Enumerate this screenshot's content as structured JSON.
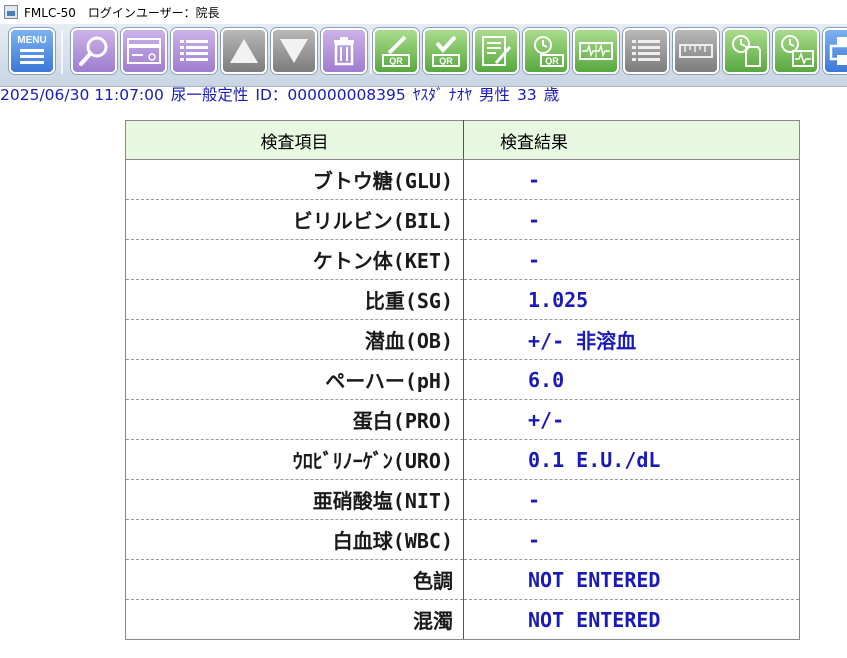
{
  "window": {
    "app_name": "FMLC-50",
    "login_user": "ログインユーザー：院長"
  },
  "toolbar": {
    "menu_label": "MENU",
    "buttons": [
      {
        "icon": "menu-icon",
        "color": "blue"
      },
      {
        "icon": "magnifier-icon",
        "color": "purple"
      },
      {
        "icon": "card-icon",
        "color": "purple"
      },
      {
        "icon": "list-icon",
        "color": "purple"
      },
      {
        "icon": "arrow-up-icon",
        "color": "gray"
      },
      {
        "icon": "arrow-down-icon",
        "color": "gray"
      },
      {
        "icon": "trash-icon",
        "color": "purple"
      },
      {
        "icon": "edit-qr-icon",
        "color": "green"
      },
      {
        "icon": "check-qr-icon",
        "color": "green"
      },
      {
        "icon": "report-edit-icon",
        "color": "green"
      },
      {
        "icon": "clock-qr-icon",
        "color": "green"
      },
      {
        "icon": "waveform-icon",
        "color": "green"
      },
      {
        "icon": "list-icon",
        "color": "gray"
      },
      {
        "icon": "ruler-icon",
        "color": "gray"
      },
      {
        "icon": "clock-doc-icon",
        "color": "green"
      },
      {
        "icon": "clock-wave-icon",
        "color": "green"
      },
      {
        "icon": "printer-icon",
        "color": "blue"
      }
    ],
    "qr_text": "QR"
  },
  "patient": {
    "datetime": "2025/06/30 11:07:00",
    "test_type": "尿一般定性",
    "id": "ID：000000008395",
    "name": "ﾔｽﾀﾞ ﾅｵﾔ",
    "sex": "男性",
    "age": "33",
    "age_unit": "歳"
  },
  "table": {
    "headers": [
      "検査項目",
      "検査結果"
    ],
    "rows": [
      {
        "item": "ブトウ糖(GLU)",
        "result": "-"
      },
      {
        "item": "ビリルビン(BIL)",
        "result": "-"
      },
      {
        "item": "ケトン体(KET)",
        "result": "-"
      },
      {
        "item": "比重(SG)",
        "result": "1.025"
      },
      {
        "item": "潜血(OB)",
        "result": "+/- 非溶血"
      },
      {
        "item": "ペーハー(pH)",
        "result": "6.0"
      },
      {
        "item": "蛋白(PRO)",
        "result": "+/-"
      },
      {
        "item": "ｳﾛﾋﾞﾘﾉｰｹﾞﾝ(URO)",
        "result": "0.1 E.U./dL"
      },
      {
        "item": "亜硝酸塩(NIT)",
        "result": "-"
      },
      {
        "item": "白血球(WBC)",
        "result": "-"
      },
      {
        "item": "色調",
        "result": "NOT ENTERED"
      },
      {
        "item": "混濁",
        "result": "NOT ENTERED"
      }
    ]
  },
  "colors": {
    "result_text": "#1a1ab8",
    "header_bg": "#e8f8e0"
  }
}
